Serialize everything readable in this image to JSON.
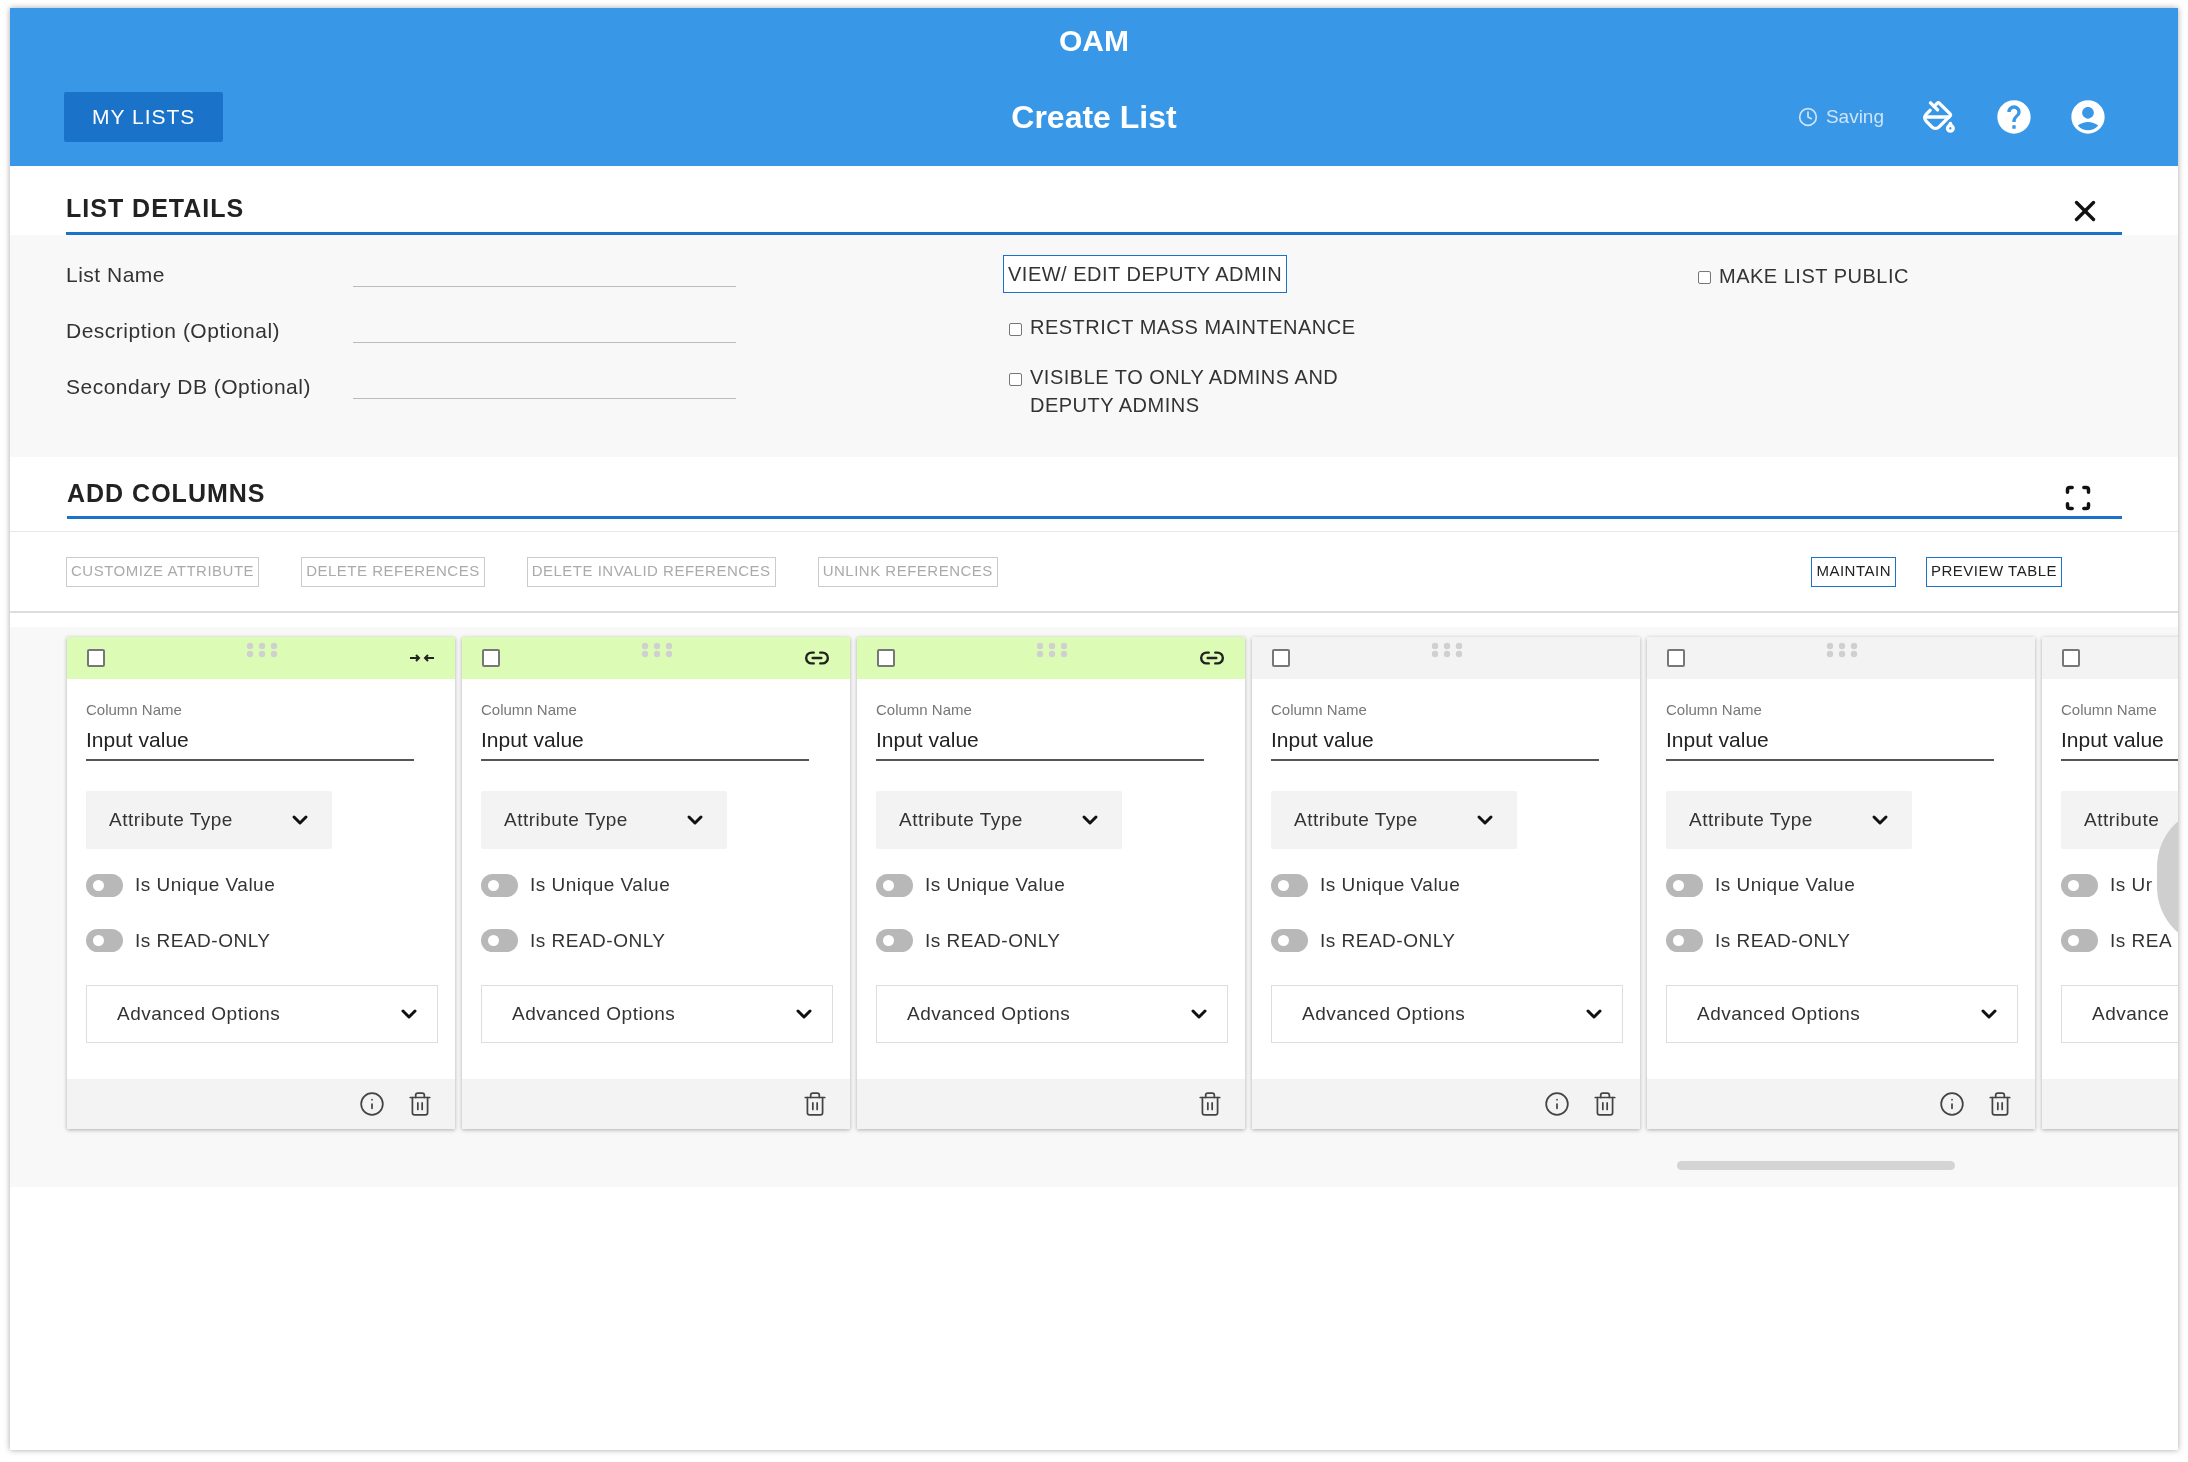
{
  "app_title": "OAM",
  "header": {
    "my_lists": "MY LISTS",
    "title": "Create List",
    "saving": "Saving"
  },
  "list_details": {
    "title": "LIST DETAILS",
    "fields": [
      {
        "label": "List Name"
      },
      {
        "label": "Description (Optional)"
      },
      {
        "label": "Secondary DB (Optional)"
      }
    ],
    "deputy_button": "VIEW/ EDIT DEPUTY ADMIN",
    "options": [
      {
        "label": "RESTRICT MASS MAINTENANCE",
        "checked": false
      },
      {
        "label": "VISIBLE TO ONLY ADMINS AND DEPUTY ADMINS",
        "checked": false
      }
    ],
    "public_option": {
      "label": "MAKE LIST PUBLIC",
      "checked": false
    }
  },
  "add_columns": {
    "title": "ADD COLUMNS",
    "actions": [
      {
        "label": "CUSTOMIZE ATTRIBUTE",
        "disabled": true
      },
      {
        "label": "DELETE REFERENCES",
        "disabled": true
      },
      {
        "label": "DELETE INVALID REFERENCES",
        "disabled": true
      },
      {
        "label": "UNLINK REFERENCES",
        "disabled": true
      }
    ],
    "right_actions": [
      {
        "label": "MAINTAIN",
        "disabled": false
      },
      {
        "label": "PREVIEW TABLE",
        "disabled": false
      }
    ],
    "cards": [
      {
        "highlighted": true,
        "merged": true,
        "linked": false,
        "checked": false,
        "column_label": "Column Name",
        "value": "Input value",
        "type": "Attribute Type",
        "toggles": [
          {
            "label": "Is Unique Value",
            "on": false
          },
          {
            "label": "Is READ-ONLY",
            "on": false
          }
        ],
        "advanced": "Advanced Options",
        "info": true,
        "trash": true
      },
      {
        "highlighted": true,
        "merged": false,
        "linked": true,
        "checked": false,
        "column_label": "Column Name",
        "value": "Input value",
        "type": "Attribute Type",
        "toggles": [
          {
            "label": "Is Unique Value",
            "on": false
          },
          {
            "label": "Is READ-ONLY",
            "on": false
          }
        ],
        "advanced": "Advanced Options",
        "info": false,
        "trash": true
      },
      {
        "highlighted": true,
        "merged": false,
        "linked": true,
        "checked": false,
        "column_label": "Column Name",
        "value": "Input value",
        "type": "Attribute Type",
        "toggles": [
          {
            "label": "Is Unique Value",
            "on": false
          },
          {
            "label": "Is READ-ONLY",
            "on": false
          }
        ],
        "advanced": "Advanced Options",
        "info": false,
        "trash": true
      },
      {
        "highlighted": false,
        "merged": false,
        "linked": false,
        "checked": false,
        "column_label": "Column Name",
        "value": "Input value",
        "type": "Attribute Type",
        "toggles": [
          {
            "label": "Is Unique Value",
            "on": false
          },
          {
            "label": "Is READ-ONLY",
            "on": false
          }
        ],
        "advanced": "Advanced Options",
        "info": true,
        "trash": true
      },
      {
        "highlighted": false,
        "merged": false,
        "linked": false,
        "checked": false,
        "column_label": "Column Name",
        "value": "Input value",
        "type": "Attribute Type",
        "toggles": [
          {
            "label": "Is Unique Value",
            "on": false
          },
          {
            "label": "Is READ-ONLY",
            "on": false
          }
        ],
        "advanced": "Advanced Options",
        "info": true,
        "trash": true
      },
      {
        "highlighted": false,
        "checked": false,
        "column_label": "Column Name",
        "value": "Input value",
        "type": "Attribute",
        "toggles": [
          {
            "label": "Is Ur",
            "on": false
          },
          {
            "label": "Is REA",
            "on": false
          }
        ],
        "advanced": "Advance"
      }
    ]
  }
}
